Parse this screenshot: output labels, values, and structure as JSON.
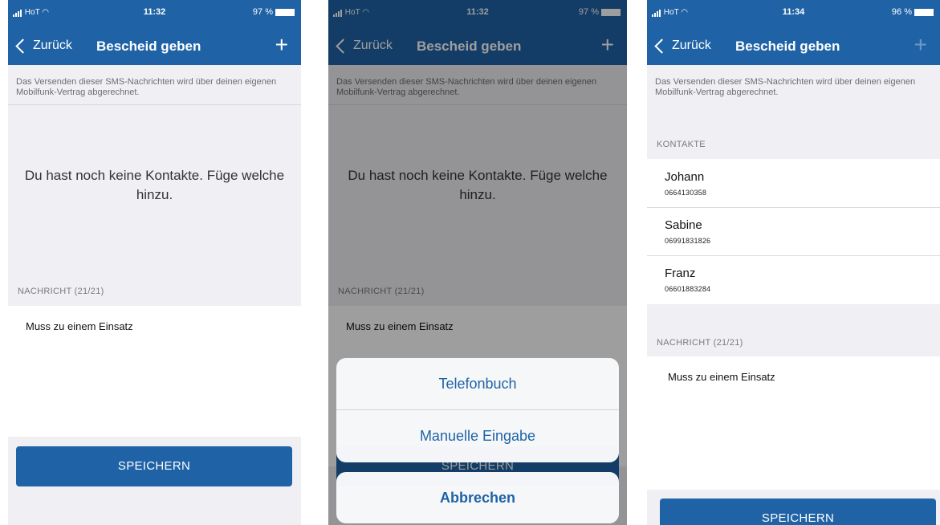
{
  "colors": {
    "brand_blue": "#1f63a6",
    "background": "#efeff4"
  },
  "screens": [
    {
      "status": {
        "carrier": "HoT",
        "time": "11:32",
        "battery": "97 %"
      },
      "nav": {
        "back_label": "Zurück",
        "title": "Bescheid geben",
        "add_icon": "plus-icon"
      },
      "info_text": "Das Versenden dieser SMS-Nachrichten wird über deinen eigenen Mobilfunk-Vertrag abgerechnet.",
      "empty_text": "Du hast noch keine Kontakte. Füge welche hinzu.",
      "message_header": "NACHRICHT (21/21)",
      "message_text": "Muss zu einem Einsatz",
      "save_label": "SPEICHERN"
    },
    {
      "status": {
        "carrier": "HoT",
        "time": "11:32",
        "battery": "97 %"
      },
      "nav": {
        "back_label": "Zurück",
        "title": "Bescheid geben",
        "add_icon": "plus-icon"
      },
      "info_text": "Das Versenden dieser SMS-Nachrichten wird über deinen eigenen Mobilfunk-Vertrag abgerechnet.",
      "empty_text": "Du hast noch keine Kontakte. Füge welche hinzu.",
      "message_header": "NACHRICHT (21/21)",
      "message_text": "Muss zu einem Einsatz",
      "save_label": "SPEICHERN",
      "action_sheet": {
        "options": [
          "Telefonbuch",
          "Manuelle Eingabe"
        ],
        "cancel": "Abbrechen"
      }
    },
    {
      "status": {
        "carrier": "HoT",
        "time": "11:34",
        "battery": "96 %"
      },
      "nav": {
        "back_label": "Zurück",
        "title": "Bescheid geben",
        "add_icon": "plus-icon"
      },
      "info_text": "Das Versenden dieser SMS-Nachrichten wird über deinen eigenen Mobilfunk-Vertrag abgerechnet.",
      "contacts_header": "KONTAKTE",
      "contacts": [
        {
          "name": "Johann",
          "number": "0664130358"
        },
        {
          "name": "Sabine",
          "number": "06991831826"
        },
        {
          "name": "Franz",
          "number": "06601883284"
        }
      ],
      "message_header": "NACHRICHT (21/21)",
      "message_text": "Muss zu einem Einsatz",
      "save_label": "SPEICHERN"
    }
  ]
}
